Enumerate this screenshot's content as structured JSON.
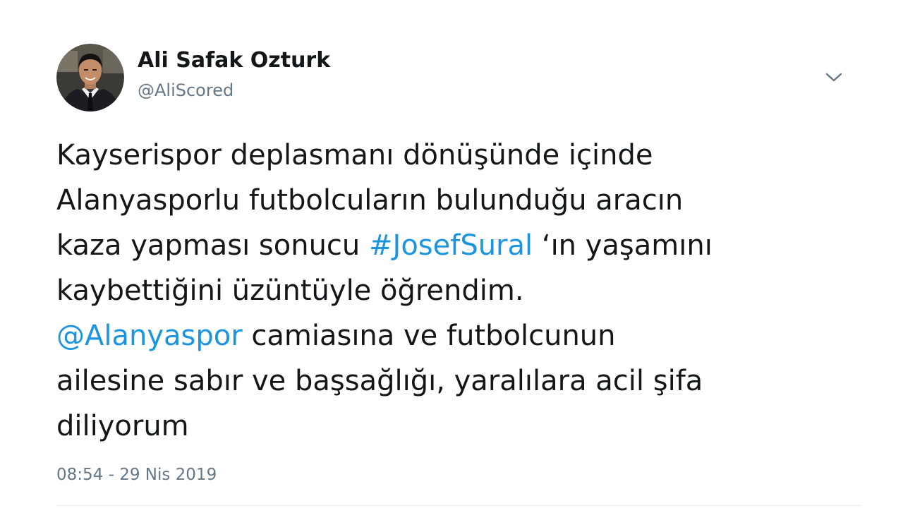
{
  "author": {
    "name": "Ali Safak Ozturk",
    "handle": "@AliScored",
    "avatar_icon": "profile-photo"
  },
  "menu": {
    "icon": "chevron-down-icon"
  },
  "tweet": {
    "lines": [
      [
        {
          "text": "Kayserispor deplasmanı dönüşünde içinde",
          "type": "text"
        }
      ],
      [
        {
          "text": "Alanyasporlu futbolcuların bulunduğu aracın",
          "type": "text"
        }
      ],
      [
        {
          "text": "kaza yapması sonucu ",
          "type": "text"
        },
        {
          "text": "#JosefSural",
          "type": "hashtag"
        },
        {
          "text": " ‘ın yaşamını",
          "type": "text"
        }
      ],
      [
        {
          "text": "kaybettiğini üzüntüyle öğrendim.",
          "type": "text"
        }
      ],
      [
        {
          "text": "@Alanyaspor",
          "type": "mention"
        },
        {
          "text": " camiasına ve futbolcunun",
          "type": "text"
        }
      ],
      [
        {
          "text": "ailesine sabır ve başsağlığı, yaralılara acil şifa",
          "type": "text"
        }
      ],
      [
        {
          "text": "diliyorum",
          "type": "text"
        }
      ]
    ],
    "timestamp": "08:54 - 29 Nis 2019"
  },
  "colors": {
    "link": "#1b95e0",
    "text": "#14171a",
    "secondary": "#657786"
  }
}
